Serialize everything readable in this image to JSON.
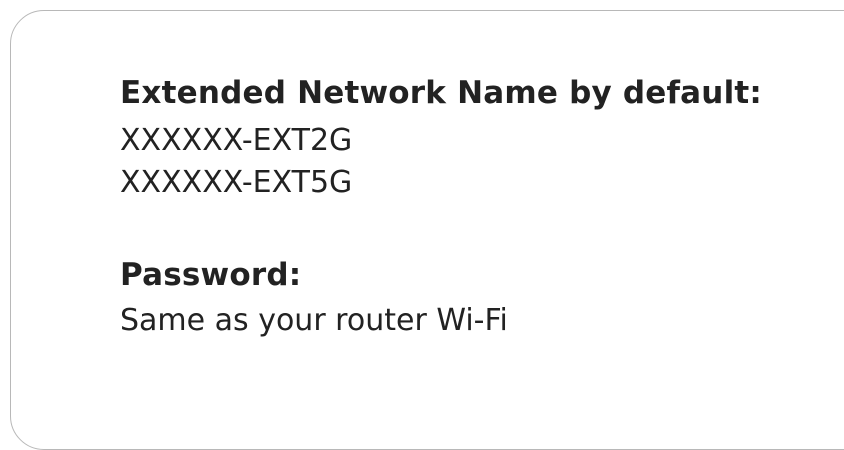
{
  "network": {
    "heading": "Extended Network Name by default:",
    "ssids": [
      "XXXXXX-EXT2G",
      "XXXXXX-EXT5G"
    ]
  },
  "password": {
    "heading": "Password:",
    "value": "Same as your router Wi-Fi"
  }
}
